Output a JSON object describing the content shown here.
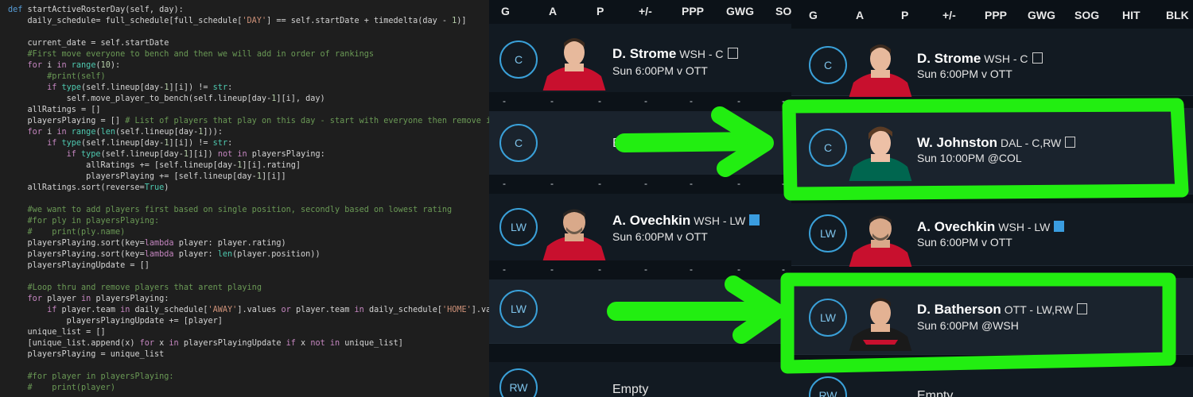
{
  "code_editor": {
    "lines": [
      "def startActiveRosterDay(self, day):",
      "    daily_schedule= full_schedule[full_schedule['DAY'] == self.startDate + timedelta(day - 1)]",
      "",
      "    current_date = self.startDate",
      "    #First move everyone to bench and then we will add in order of rankings",
      "    for i in range(10):",
      "        #print(self)",
      "        if type(self.lineup[day-1][i]) != str:",
      "            self.move_player_to_bench(self.lineup[day-1][i], day)",
      "    allRatings = []",
      "    playersPlaying = [] # List of players that play on this day - start with everyone then remove if they dont pl",
      "    for i in range(len(self.lineup[day-1])):",
      "        if type(self.lineup[day-1][i]) != str:",
      "            if type(self.lineup[day-1][i]) not in playersPlaying:",
      "                allRatings += [self.lineup[day-1][i].rating]",
      "                playersPlaying += [self.lineup[day-1][i]]",
      "    allRatings.sort(reverse=True)",
      "",
      "    #we want to add players first based on single position, secondly based on lowest rating",
      "    #for ply in playersPlaying:",
      "    #    print(ply.name)",
      "    playersPlaying.sort(key=lambda player: player.rating)",
      "    playersPlaying.sort(key=lambda player: len(player.position))",
      "    playersPlayingUpdate = []",
      "",
      "    #Loop thru and remove players that arent playing",
      "    for player in playersPlaying:",
      "        if player.team in daily_schedule['AWAY'].values or player.team in daily_schedule['HOME'].values:",
      "            playersPlayingUpdate += [player]",
      "    unique_list = []",
      "    [unique_list.append(x) for x in playersPlayingUpdate if x not in unique_list]",
      "    playersPlaying = unique_list",
      "",
      "    #for player in playersPlaying:",
      "    #    print(player)"
    ]
  },
  "before_panel": {
    "headers": [
      "G",
      "A",
      "P",
      "+/-",
      "PPP",
      "GWG",
      "SO"
    ],
    "slots": [
      {
        "position": "C",
        "player": "D. Strome",
        "team_pos": "WSH - C",
        "game": "Sun 6:00PM v OTT",
        "stats": [
          "-",
          "-",
          "-",
          "-",
          "-",
          "-",
          "-"
        ]
      },
      {
        "position": "C",
        "player": "",
        "partial_text": "E",
        "stats": [
          "-",
          "-",
          "-",
          "-",
          "-",
          "-",
          "-"
        ]
      },
      {
        "position": "LW",
        "player": "A. Ovechkin",
        "team_pos": "WSH - LW",
        "game": "Sun 6:00PM v OTT",
        "stats": [
          "-",
          "-",
          "-",
          "-",
          "-",
          "-",
          "-"
        ]
      },
      {
        "position": "LW",
        "player": "",
        "partial_text": "E"
      },
      {
        "position": "RW",
        "empty_label": "Empty"
      }
    ]
  },
  "after_panel": {
    "headers": [
      "G",
      "A",
      "P",
      "+/-",
      "PPP",
      "GWG",
      "SOG",
      "HIT",
      "BLK"
    ],
    "slots": [
      {
        "position": "C",
        "player": "D. Strome",
        "team_pos": "WSH - C",
        "game": "Sun 6:00PM v OTT"
      },
      {
        "position": "C",
        "player": "W. Johnston",
        "team_pos": "DAL - C,RW",
        "game": "Sun 10:00PM @COL"
      },
      {
        "position": "LW",
        "player": "A. Ovechkin",
        "team_pos": "WSH - LW",
        "game": "Sun 6:00PM v OTT"
      },
      {
        "position": "LW",
        "player": "D. Batherson",
        "team_pos": "OTT - LW,RW",
        "game": "Sun 6:00PM @WSH"
      },
      {
        "position": "RW",
        "empty_label": "Empty"
      }
    ]
  },
  "annotation_colors": {
    "highlight": "#22ee11"
  },
  "colors": {
    "badge": "#3aa0d8",
    "jersey_red": "#c8102e",
    "jersey_green": "#00664f"
  }
}
